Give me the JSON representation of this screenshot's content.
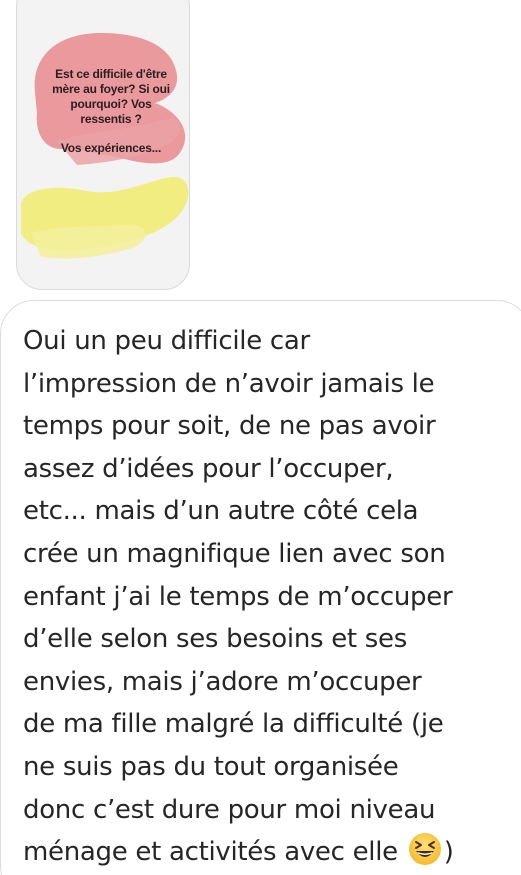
{
  "story_reply": {
    "question": "Est ce difficile d'être mère au foyer? Si oui pourquoi? Vos ressentis ?",
    "prompt": "Vos expériences..."
  },
  "message": {
    "text": "Oui un peu difficile car\nl’impression de n’avoir jamais le\ntemps pour soit, de ne pas avoir\nassez d’idées pour l’occuper,\netc... mais d’un autre côté cela\ncrée un magnifique lien avec son\nenfant j’ai le temps de m’occuper\nd’elle selon ses besoins et ses\nenvies, mais j’adore m’occuper\nde ma fille malgré la difficulté (je\nne suis pas du tout organisée\ndonc c’est dure pour moi niveau\nménage et activités avec elle ",
    "emoji": "grinning-squinting-face-emoji",
    "closing": ")"
  },
  "colors": {
    "paint_pink": "#e98f93",
    "paint_yellow": "#f0ec7a",
    "card_bg": "#f3f3f3",
    "text": "#262626"
  }
}
